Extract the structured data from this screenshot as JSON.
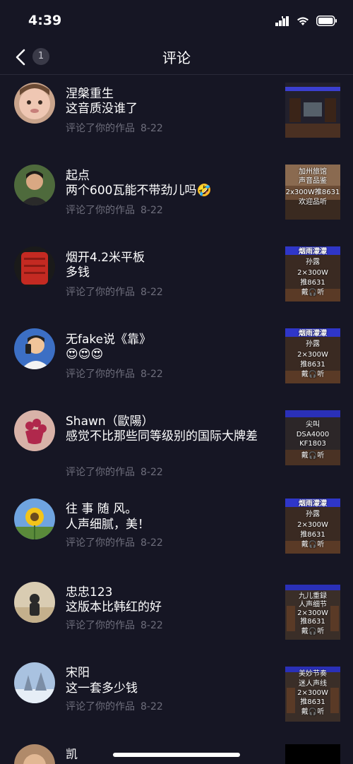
{
  "status": {
    "time": "4:39"
  },
  "nav": {
    "title": "评论",
    "back_count": "1"
  },
  "comments": [
    {
      "name": "涅槃重生",
      "text": "这音质没谁了",
      "action": "评论了你的作品",
      "date": "8-22",
      "thumb_lines": []
    },
    {
      "name": "起点",
      "text": "两个600瓦能不带劲儿吗🤣",
      "action": "评论了你的作品",
      "date": "8-22",
      "thumb_lines": [
        "加州旅馆",
        "声音品鉴",
        "2x300W推8631",
        "欢迎品听"
      ]
    },
    {
      "name": "烟开4.2米平板",
      "text": "多钱",
      "action": "评论了你的作品",
      "date": "8-22",
      "thumb_lines": [
        "烟雨濛濛",
        "孙露",
        "2×300W",
        "推8631",
        "戴🎧听"
      ]
    },
    {
      "name": "无fake说《靠》",
      "text": "😍😍😍",
      "action": "评论了你的作品",
      "date": "8-22",
      "thumb_lines": [
        "烟雨濛濛",
        "孙露",
        "2×300W",
        "推8631",
        "戴🎧听"
      ]
    },
    {
      "name": "Shawn（歐陽）",
      "text": "感觉不比那些同等级别的国际大牌差",
      "action": "评论了你的作品",
      "date": "8-22",
      "thumb_lines": [
        "尖叫",
        "DSA4000",
        "KF1803",
        "戴🎧听"
      ]
    },
    {
      "name": "往 事 随 风。",
      "text": "人声细腻，美！",
      "action": "评论了你的作品",
      "date": "8-22",
      "thumb_lines": [
        "烟雨濛濛",
        "孙露",
        "2×300W",
        "推8631",
        "戴🎧听"
      ]
    },
    {
      "name": "忠忠123",
      "text": "这版本比韩红的好",
      "action": "评论了你的作品",
      "date": "8-22",
      "thumb_lines": [
        "九儿重録",
        "人声细节",
        "2×300W",
        "推8631",
        "戴🎧听"
      ]
    },
    {
      "name": "宋阳",
      "text": "这一套多少钱",
      "action": "评论了你的作品",
      "date": "8-22",
      "thumb_lines": [
        "美妙节奏",
        "迷人声线",
        "2×300W",
        "推8631",
        "戴🎧听"
      ]
    },
    {
      "name": "凯",
      "text": "",
      "action": "",
      "date": "",
      "thumb_lines": []
    }
  ]
}
